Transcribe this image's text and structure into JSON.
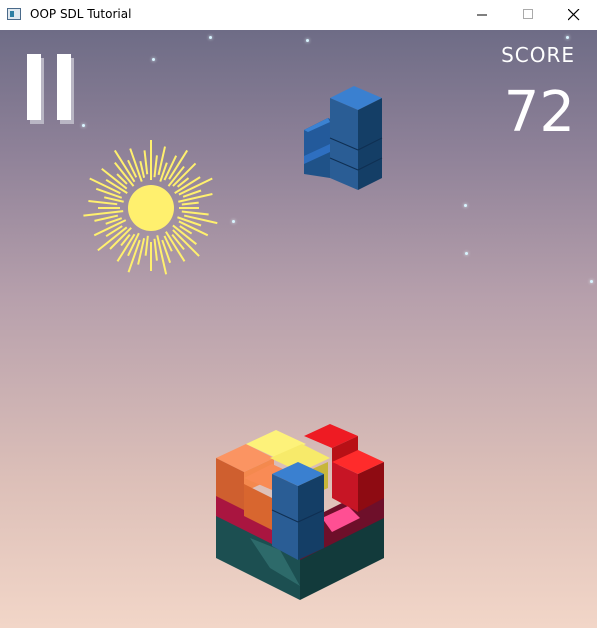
{
  "window": {
    "title": "OOP SDL Tutorial",
    "icon": "app-window-icon",
    "controls": [
      "minimize-icon",
      "maximize-icon",
      "close-icon"
    ]
  },
  "hud": {
    "score_label": "SCORE",
    "score_value": "72",
    "pause_icon": "pause-icon"
  },
  "scene": {
    "sun_color": "#fff06e",
    "background_top": "#6e6c86",
    "background_bottom": "#f2d6c8",
    "falling_piece_color": "#2e6fc0",
    "stack_colors": [
      "#fdf27a",
      "#f4894e",
      "#ee1b23",
      "#c4174a",
      "#ff4f93",
      "#2e6fc0",
      "#1e5a5a"
    ]
  }
}
